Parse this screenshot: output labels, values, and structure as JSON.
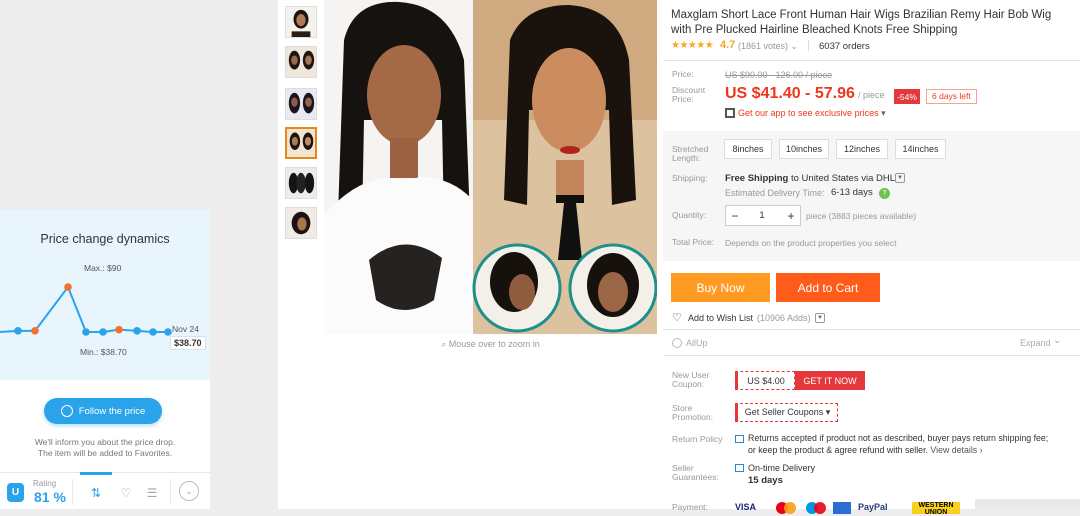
{
  "price_widget": {
    "title": "Price change dynamics",
    "max_label": "Max.: $90",
    "min_label": "Min.: $38.70",
    "latest_date": "Nov 24",
    "latest_price": "$38.70",
    "follow_label": "Follow the price",
    "note_line1": "We'll inform you about the price drop.",
    "note_line2": "The item will be added to Favorites.",
    "rating_logo": "U",
    "rating_label": "Rating",
    "rating_value": "81 %",
    "tabs": [
      {
        "icon": "trend-chart-icon",
        "active": true
      },
      {
        "icon": "heart-icon",
        "active": false
      },
      {
        "icon": "list-icon",
        "active": false
      }
    ],
    "colors": {
      "accent": "#2ba3ea",
      "chart_bg": "#e8f5fd",
      "max_point": "#f4712b"
    }
  },
  "chart_data": {
    "type": "line",
    "title": "Price change dynamics",
    "x": [
      "",
      "",
      "",
      "",
      "",
      "",
      "",
      "",
      "",
      "Nov 24"
    ],
    "values": [
      38.7,
      40,
      40,
      90,
      38.7,
      38.7,
      41.4,
      40,
      38.7,
      38.7
    ],
    "ylim": [
      30,
      100
    ],
    "annotations": [
      "Max.: $90",
      "Min.: $38.70"
    ],
    "grid": false,
    "legend": "none"
  },
  "gallery": {
    "thumbnails": [
      "thumb-1",
      "thumb-2",
      "thumb-3",
      "thumb-4",
      "thumb-5",
      "thumb-6"
    ],
    "active_index": 3,
    "zoom_hint": "Mouse over to zoom in"
  },
  "product": {
    "title": "Maxglam Short Lace Front Human Hair Wigs Brazilian Remy Hair Bob Wig with Pre Plucked Hairline Bleached Knots Free Shipping",
    "stars": "★★★★★",
    "rating": "4.7",
    "votes": "(1861 votes)",
    "orders": "6037 orders",
    "price_label": "Price:",
    "original_price": "US $90.00 - 126.00 / piece",
    "discount_label_1": "Discount",
    "discount_label_2": "Price:",
    "discount_price": "US $41.40 - 57.96",
    "per_piece": "/ piece",
    "discount_badge": "-54%",
    "days_left": "6 days left",
    "app_link": "Get our app to see exclusive prices",
    "stretched_label_1": "Stretched",
    "stretched_label_2": "Length:",
    "sizes": [
      "8inches",
      "10inches",
      "12inches",
      "14inches"
    ],
    "shipping_label": "Shipping:",
    "shipping_free": "Free Shipping",
    "shipping_rest": " to United States via DHL",
    "eta_label": "Estimated Delivery Time:",
    "eta_days": "6-13 days",
    "quantity_label": "Quantity:",
    "quantity_value": "1",
    "quantity_avail": "piece (3883 pieces available)",
    "total_label": "Total Price:",
    "total_value": "Depends on the product properties you select",
    "buy_now": "Buy Now",
    "add_to_cart": "Add to Cart",
    "wish_label": "Add to Wish List",
    "wish_count": "(10906 Adds)",
    "allup": "AllUp",
    "expand": "Expand",
    "new_user_label_1": "New User",
    "new_user_label_2": "Coupon:",
    "coupon_amount": "US $4.00",
    "coupon_button": "GET IT NOW",
    "store_label_1": "Store",
    "store_label_2": "Promotion:",
    "seller_coupons": "Get Seller Coupons ▾",
    "return_label": "Return Policy",
    "return_text": "Returns accepted if product not as described, buyer pays return shipping fee; or keep the product & agree refund with seller.",
    "return_link": " View details ›",
    "guarantee_label_1": "Seller",
    "guarantee_label_2": "Guarantees:",
    "guarantee_text": "On-time Delivery",
    "guarantee_days": "15 days",
    "payment_label": "Payment:",
    "payment_methods": [
      "VISA",
      "mastercard",
      "maestro",
      "amex",
      "PayPal",
      "WESTERN UNION"
    ],
    "colors": {
      "price_red": "#f0361d",
      "buy_now": "#ff9a23",
      "add_to_cart": "#ff5b1a",
      "star": "#f6a821"
    }
  }
}
